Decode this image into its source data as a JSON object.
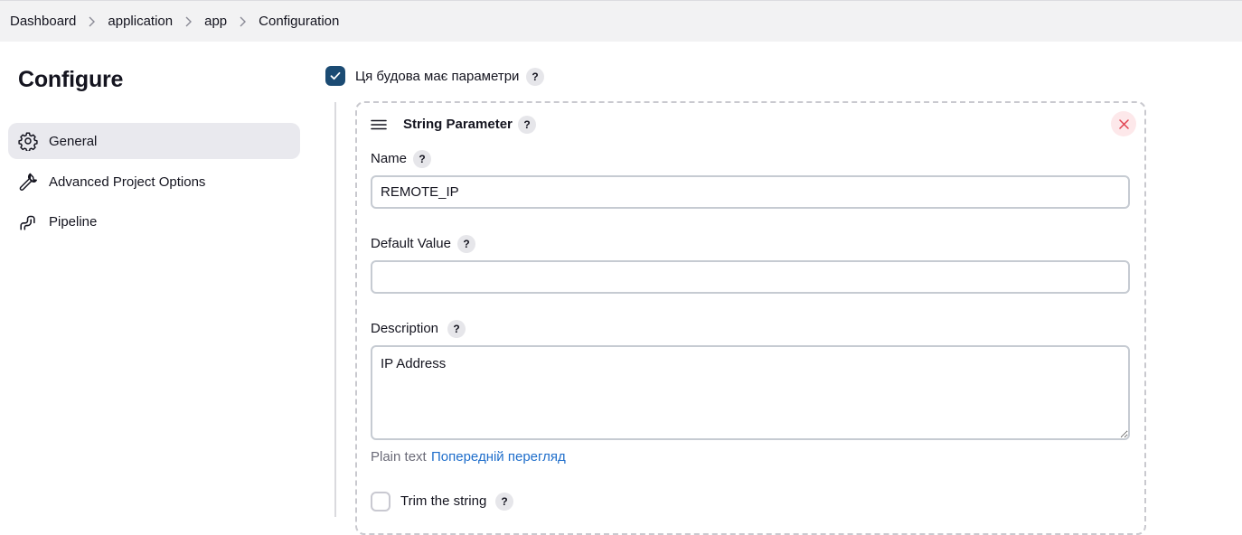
{
  "breadcrumb": {
    "items": [
      "Dashboard",
      "application",
      "app",
      "Configuration"
    ]
  },
  "sidebar": {
    "title": "Configure",
    "items": [
      {
        "label": "General",
        "icon": "gear-icon",
        "active": true
      },
      {
        "label": "Advanced Project Options",
        "icon": "wrench-icon",
        "active": false
      },
      {
        "label": "Pipeline",
        "icon": "pipeline-icon",
        "active": false
      }
    ]
  },
  "main": {
    "parameterized": {
      "label": "Ця будова має параметри",
      "checked": true,
      "help": "?"
    },
    "string_parameter": {
      "title": "String Parameter",
      "help": "?",
      "name": {
        "label": "Name",
        "help": "?",
        "value": "REMOTE_IP"
      },
      "default_value": {
        "label": "Default Value",
        "help": "?",
        "value": ""
      },
      "description": {
        "label": "Description",
        "help": "?",
        "value": "IP Address"
      },
      "format_hint": "Plain text",
      "preview_link": "Попередній перегляд",
      "trim": {
        "label": "Trim the string",
        "help": "?",
        "checked": false
      }
    }
  },
  "colors": {
    "accent": "#1b4b73",
    "link": "#1f6ecb",
    "close": "#e0414f"
  }
}
